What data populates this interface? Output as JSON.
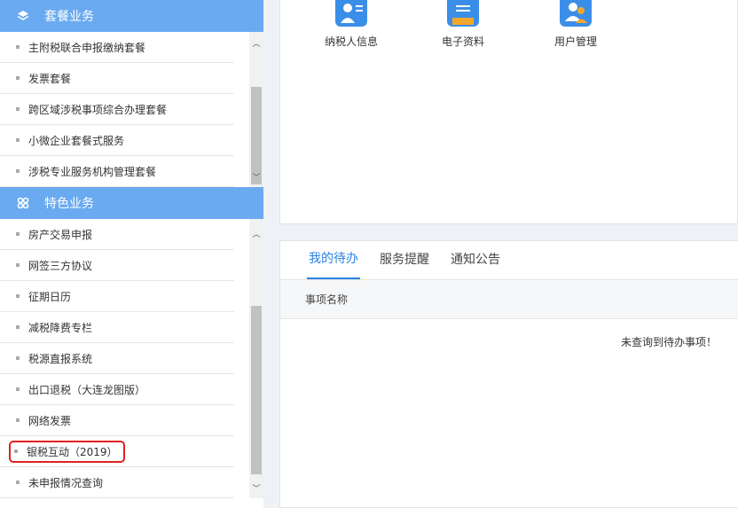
{
  "sidebar": {
    "package_section": {
      "title": "套餐业务",
      "items": [
        "主附税联合申报缴纳套餐",
        "发票套餐",
        "跨区域涉税事项综合办理套餐",
        "小微企业套餐式服务",
        "涉税专业服务机构管理套餐"
      ]
    },
    "special_section": {
      "title": "特色业务",
      "items": [
        "房产交易申报",
        "网签三方协议",
        "征期日历",
        "减税降费专栏",
        "税源直报系统",
        "出口退税（大连龙图版）",
        "网络发票",
        "银税互动（2019）",
        "未申报情况查询"
      ]
    }
  },
  "apps": [
    {
      "label": "纳税人信息",
      "icon": "user-card-icon",
      "color": "#3b8ee8"
    },
    {
      "label": "电子资料",
      "icon": "document-icon",
      "color": "#3b8ee8"
    },
    {
      "label": "用户管理",
      "icon": "users-icon",
      "color": "#3b8ee8"
    }
  ],
  "tabs": [
    {
      "label": "我的待办",
      "active": true
    },
    {
      "label": "服务提醒",
      "active": false
    },
    {
      "label": "通知公告",
      "active": false
    }
  ],
  "table": {
    "column": "事项名称",
    "empty_message": "未查询到待办事项！"
  },
  "colors": {
    "section_header": "#6aaaf0",
    "accent": "#2a82e4",
    "highlight": "#e02020"
  }
}
